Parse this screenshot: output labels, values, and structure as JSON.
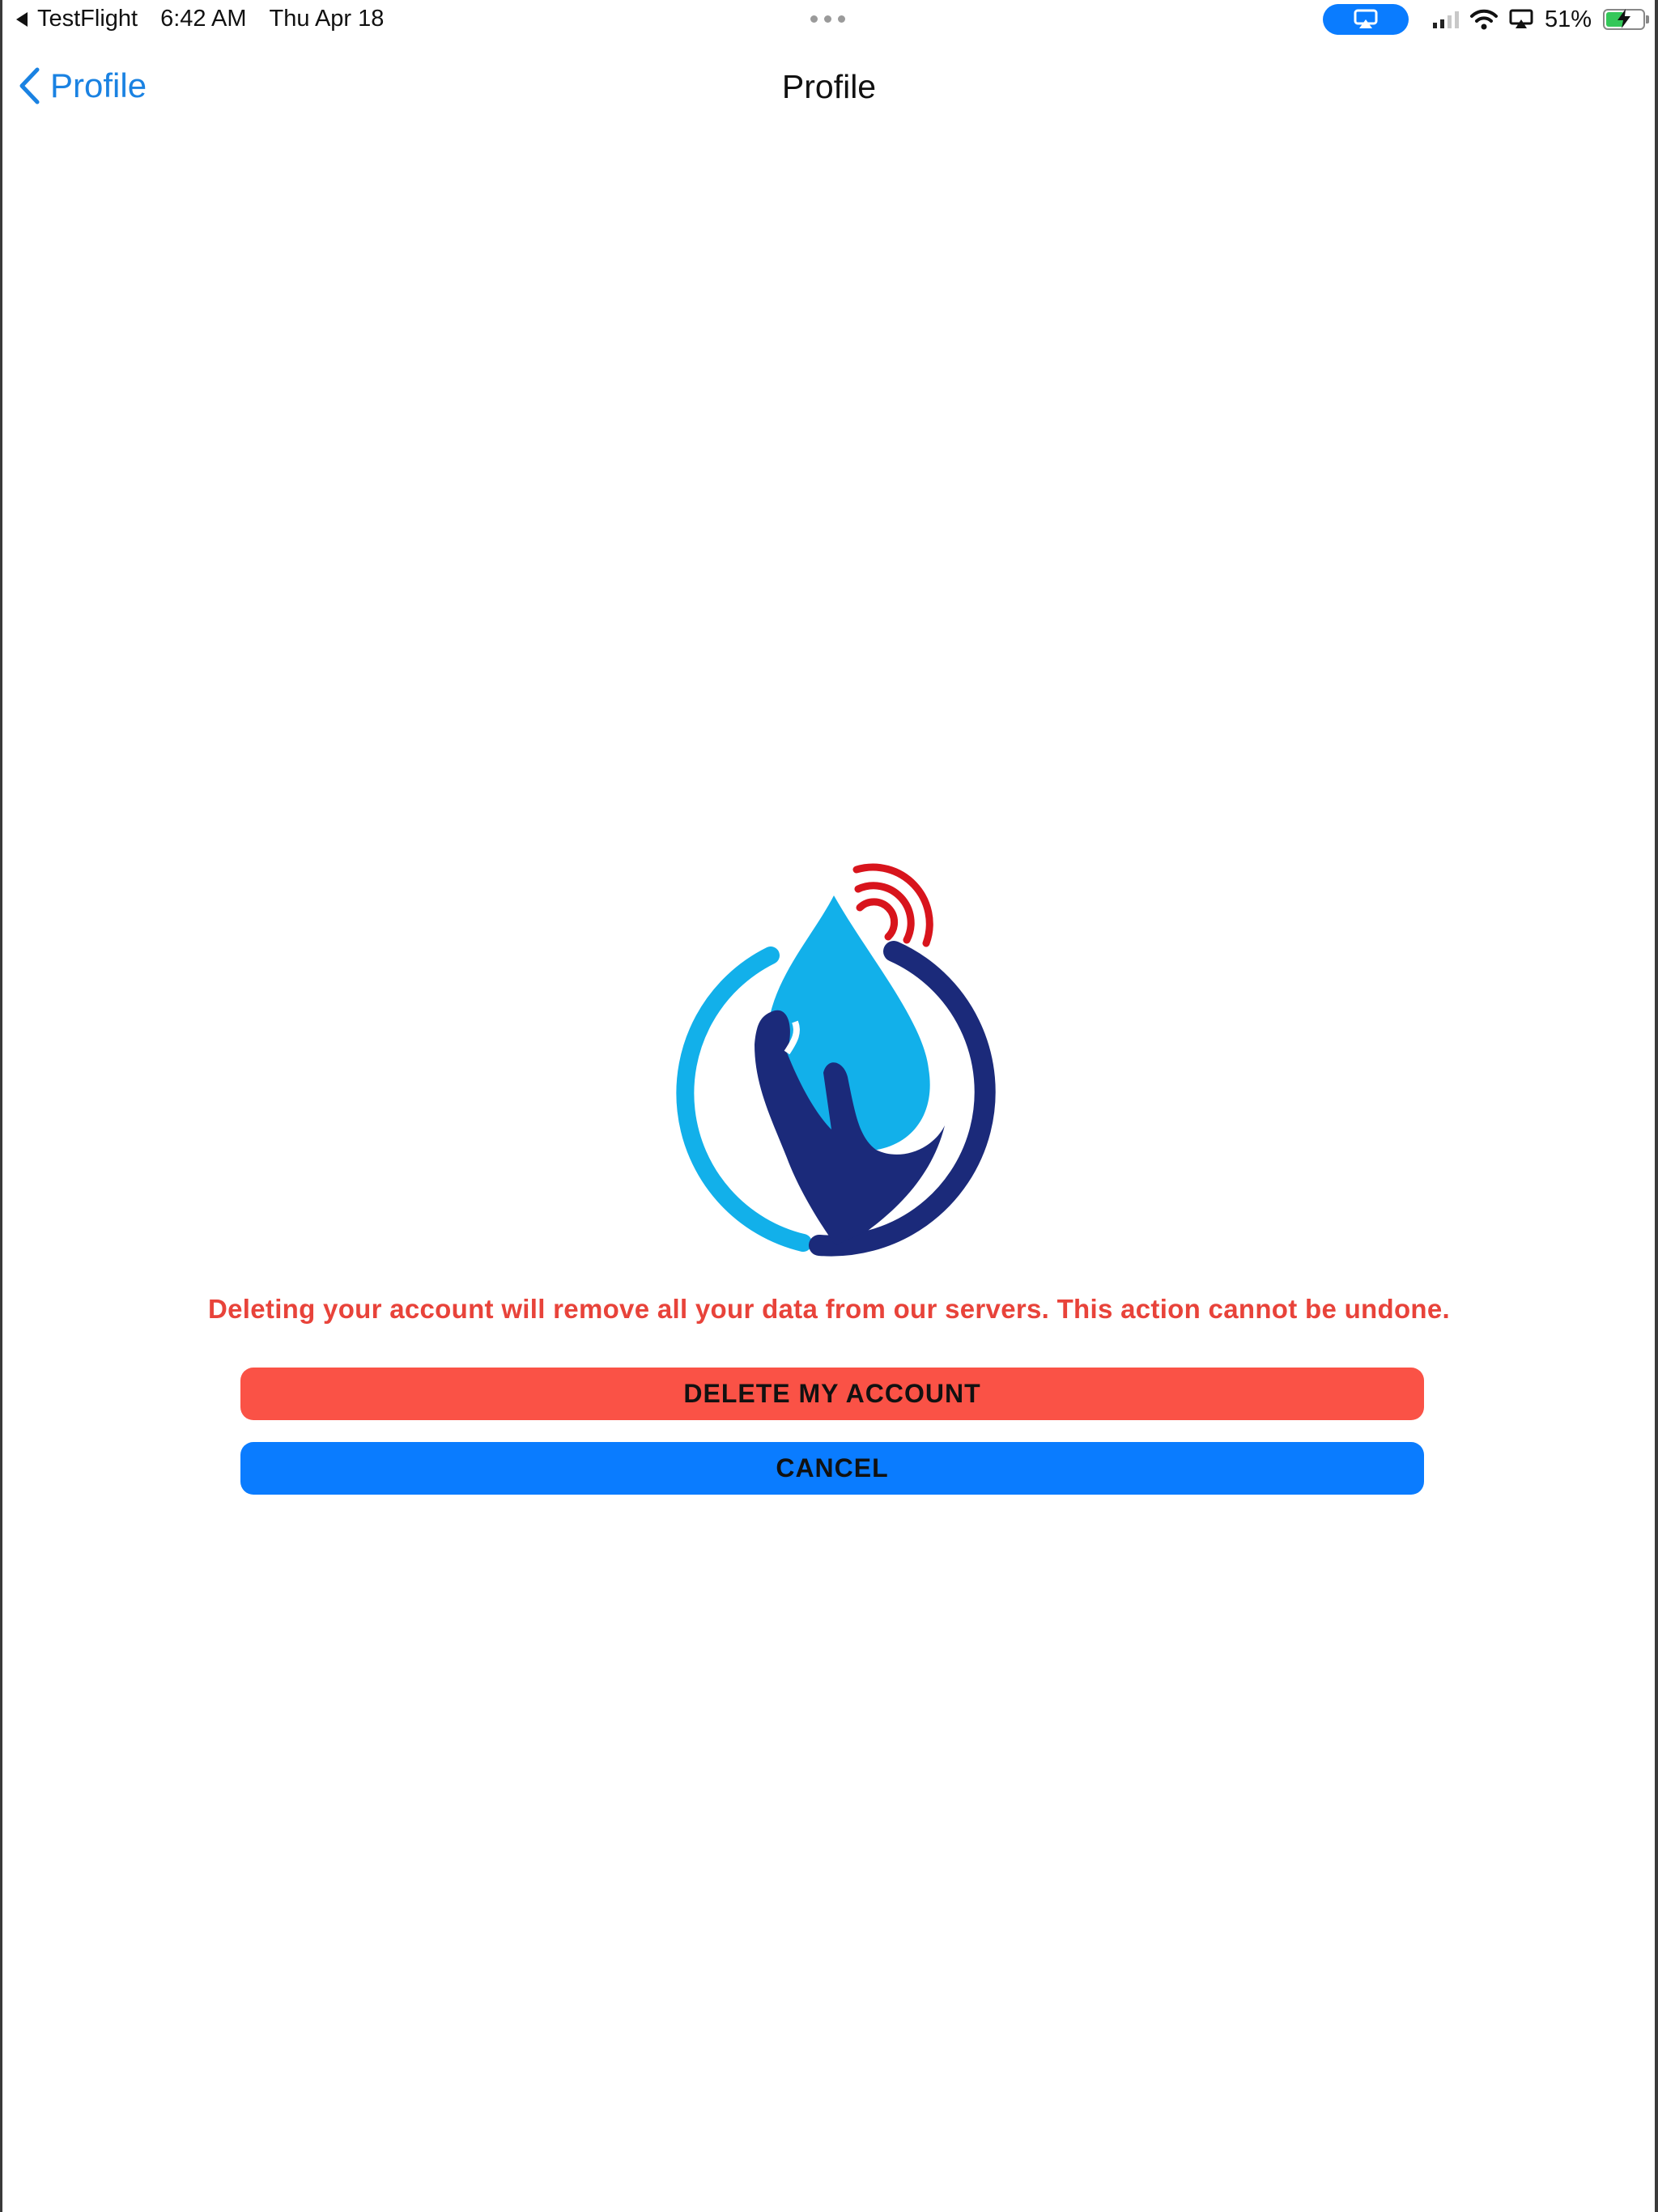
{
  "status_bar": {
    "back_app": "TestFlight",
    "time": "6:42 AM",
    "date": "Thu Apr 18",
    "battery_percent": "51%",
    "battery_level": 0.51,
    "charging": true,
    "icons": [
      "back-triangle-icon",
      "more-dots-icon",
      "airplay-icon",
      "cellular-signal-icon",
      "wifi-icon",
      "screen-mirroring-icon",
      "battery-charging-icon"
    ]
  },
  "nav": {
    "back_label": "Profile",
    "title": "Profile"
  },
  "logo": {
    "icon": "water-drop-hand-signal-logo",
    "colors": {
      "light_blue": "#12b0ea",
      "navy": "#1b2a7a",
      "red": "#d8141c"
    }
  },
  "warning_text": "Deleting your account will remove all your data from our servers. This action cannot be undone.",
  "buttons": {
    "delete_label": "DELETE MY ACCOUNT",
    "cancel_label": "CANCEL"
  },
  "colors": {
    "accent_blue": "#0a7cff",
    "danger_red": "#fa5246",
    "warning_text": "#e8433a",
    "link_blue": "#1a82e2"
  }
}
